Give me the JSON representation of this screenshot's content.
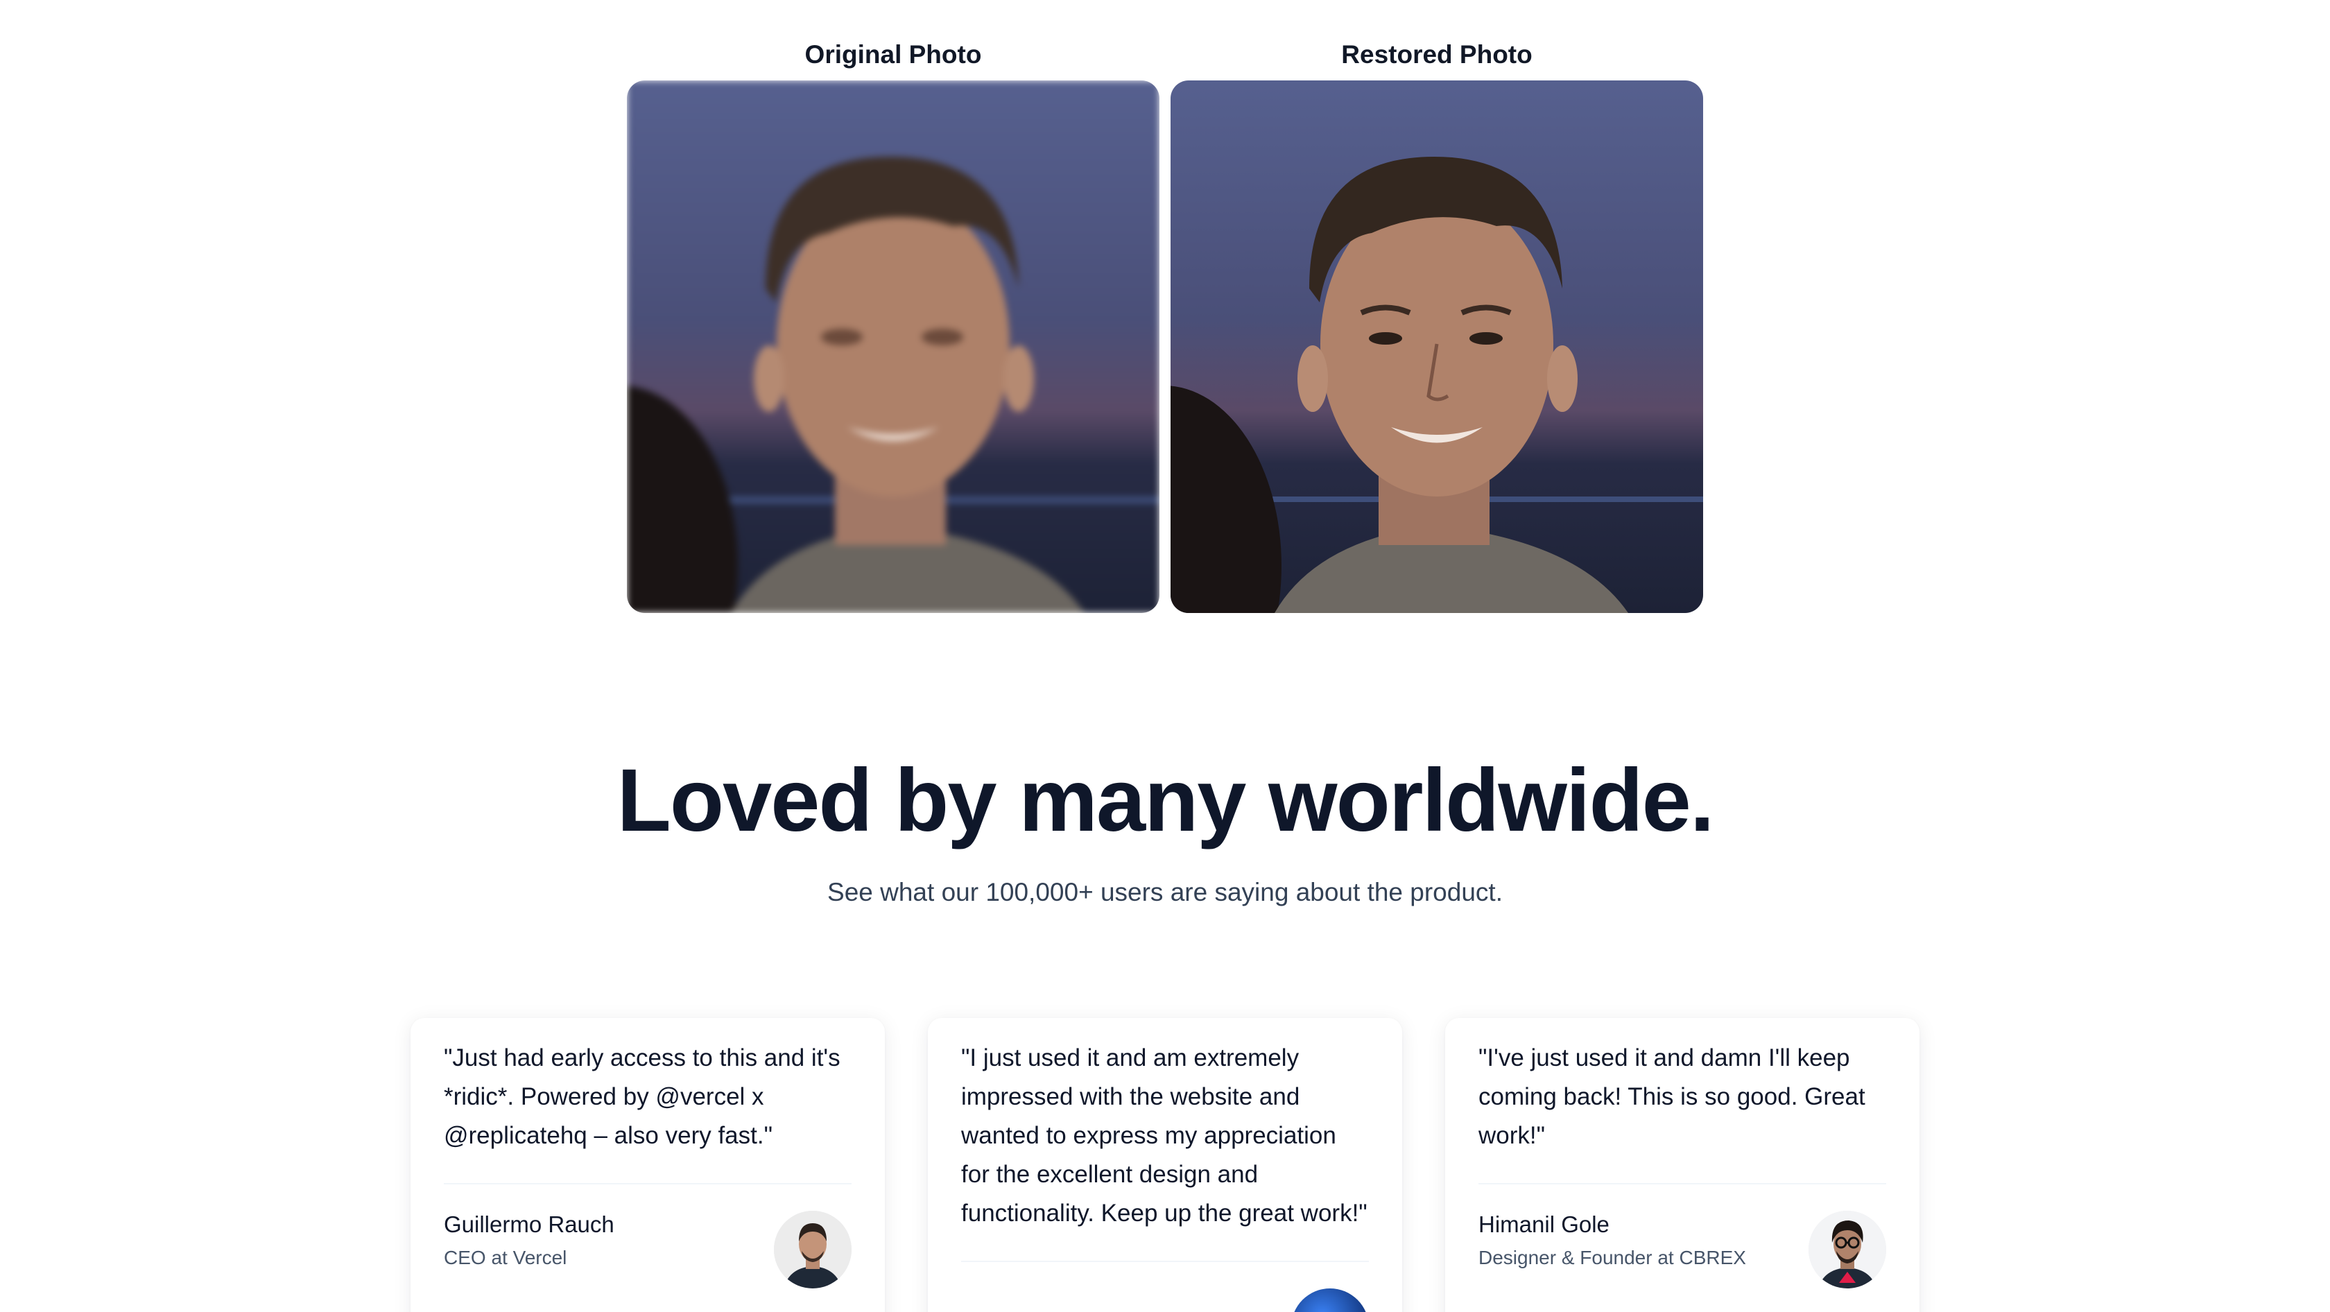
{
  "comparison": {
    "original_label": "Original Photo",
    "restored_label": "Restored Photo"
  },
  "heading": "Loved by many worldwide.",
  "subheading": "See what our 100,000+ users are saying about the product.",
  "testimonials": [
    {
      "quote": "\"Just had early access to this and it's *ridic*. Powered by @vercel x @replicatehq – also very fast.\"",
      "name": "Guillermo Rauch",
      "role": "CEO at Vercel"
    },
    {
      "quote": "\"I just used it and am extremely impressed with the website and wanted to express my appreciation for the excellent design and functionality. Keep up the great work!\"",
      "name": "",
      "role": ""
    },
    {
      "quote": "\"I've just used it and damn I'll keep coming back! This is so good. Great work!\"",
      "name": "Himanil Gole",
      "role": "Designer & Founder at CBREX"
    }
  ]
}
